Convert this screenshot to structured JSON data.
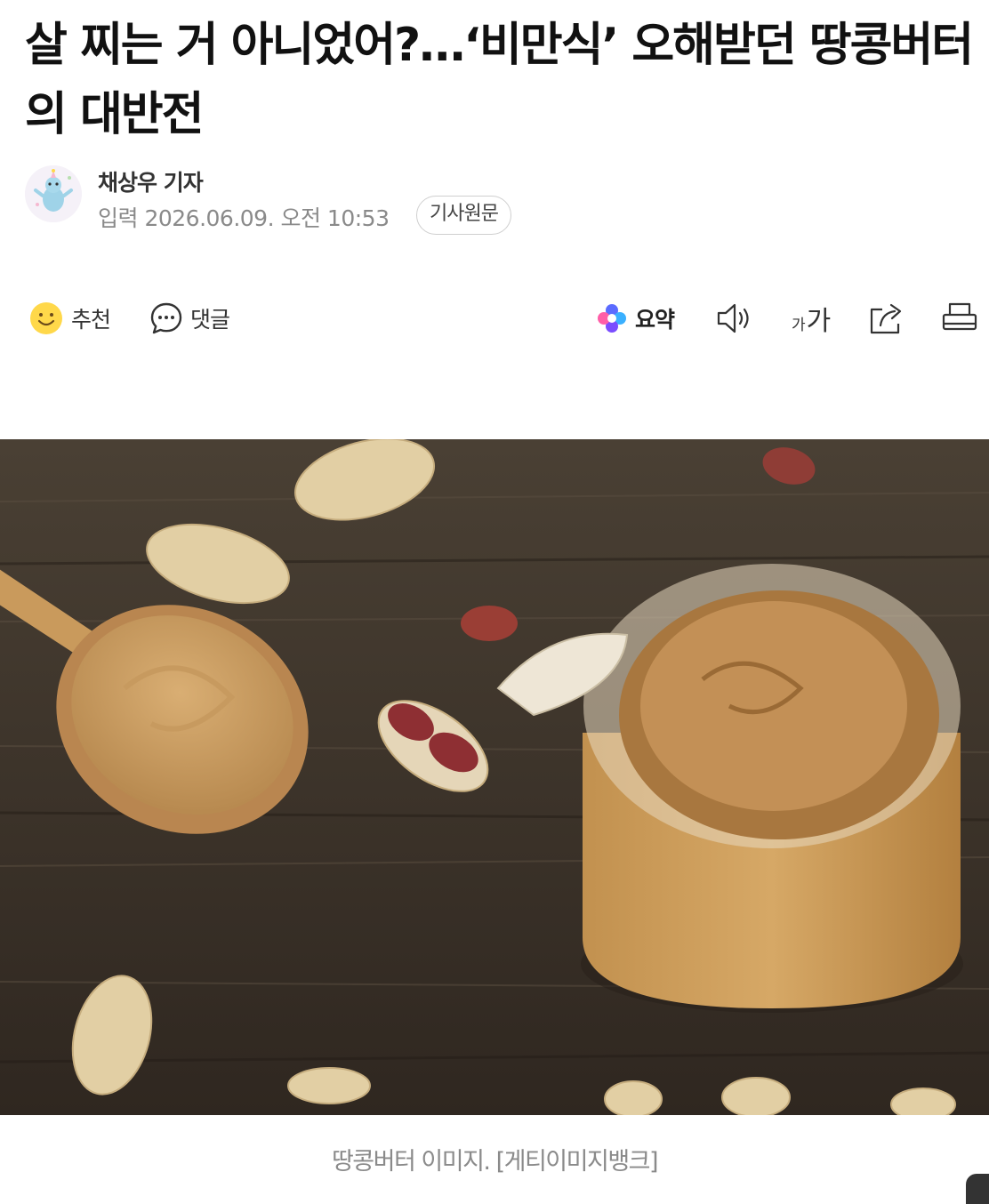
{
  "article": {
    "headline": "살 찌는 거 아니었어?…‘비만식’ 오해받던 땅콩버터의 대반전",
    "reporter": "채상우 기자",
    "date": "입력 2026.06.09. 오전 10:53",
    "original_link": "기사원문"
  },
  "toolbar": {
    "recommend_label": "추천",
    "comment_label": "댓글",
    "summary_label": "요약",
    "font_small": "가",
    "font_large": "가"
  },
  "photo": {
    "caption": "땅콩버터 이미지. [게티이미지뱅크]"
  },
  "colors": {
    "text": "#111111",
    "muted": "#8a8a8a",
    "emoji_yellow": "#ffd84a",
    "summary_blue": "#3b5bff",
    "wood_dark": "#3a3026",
    "peanut_butter": "#c89a5e"
  },
  "icons": {
    "recommend": "smile-emoji-icon",
    "comment": "speech-bubble-icon",
    "summary": "sparkle-flower-icon",
    "tts": "speaker-icon",
    "font_size": "font-size-icon",
    "share": "share-icon",
    "print": "print-icon"
  }
}
